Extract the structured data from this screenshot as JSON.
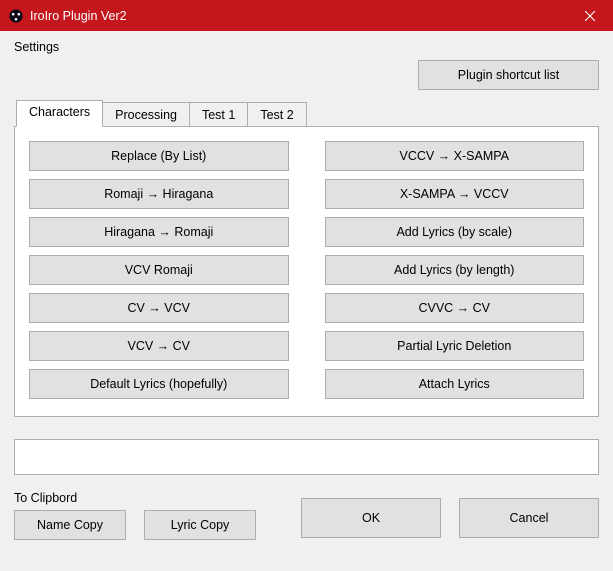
{
  "window": {
    "title": "IroIro Plugin Ver2"
  },
  "settings_label": "Settings",
  "shortcut_button": "Plugin shortcut list",
  "tabs": {
    "t0": "Characters",
    "t1": "Processing",
    "t2": "Test 1",
    "t3": "Test 2"
  },
  "left_actions": {
    "a0": "Replace (By List)",
    "a1": "Romaji → Hiragana",
    "a2": "Hiragana → Romaji",
    "a3": "VCV Romaji",
    "a4": "CV → VCV",
    "a5": "VCV → CV",
    "a6": "Default Lyrics (hopefully)"
  },
  "right_actions": {
    "b0": "VCCV → X-SAMPA",
    "b1": "X-SAMPA → VCCV",
    "b2": "Add Lyrics (by scale)",
    "b3": "Add Lyrics (by length)",
    "b4": "CVVC → CV",
    "b5": "Partial Lyric Deletion",
    "b6": "Attach Lyrics"
  },
  "clipboard_label": "To Clipbord",
  "name_copy": "Name Copy",
  "lyric_copy": "Lyric Copy",
  "ok": "OK",
  "cancel": "Cancel"
}
